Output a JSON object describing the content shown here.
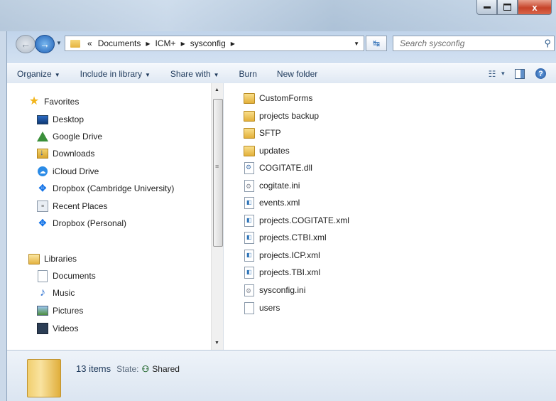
{
  "window": {
    "caption_buttons": [
      "minimize",
      "maximize",
      "close"
    ],
    "close_glyph": "x"
  },
  "address": {
    "overflow": "«",
    "crumbs": [
      "Documents",
      "ICM+",
      "sysconfig"
    ],
    "search_placeholder": "Search sysconfig"
  },
  "toolbar": {
    "organize": "Organize",
    "include": "Include in library",
    "share": "Share with",
    "burn": "Burn",
    "new_folder": "New folder"
  },
  "nav": {
    "favorites_label": "Favorites",
    "favorites": [
      "Desktop",
      "Google Drive",
      "Downloads",
      "iCloud Drive",
      "Dropbox (Cambridge University)",
      "Recent Places",
      "Dropbox (Personal)"
    ],
    "libraries_label": "Libraries",
    "libraries": [
      "Documents",
      "Music",
      "Pictures",
      "Videos"
    ]
  },
  "files": [
    {
      "name": "CustomForms",
      "type": "folder"
    },
    {
      "name": "projects backup",
      "type": "folder"
    },
    {
      "name": "SFTP",
      "type": "folder"
    },
    {
      "name": "updates",
      "type": "folder"
    },
    {
      "name": "COGITATE.dll",
      "type": "dll"
    },
    {
      "name": "cogitate.ini",
      "type": "ini"
    },
    {
      "name": "events.xml",
      "type": "xml"
    },
    {
      "name": "projects.COGITATE.xml",
      "type": "xml"
    },
    {
      "name": "projects.CTBI.xml",
      "type": "xml"
    },
    {
      "name": "projects.ICP.xml",
      "type": "xml"
    },
    {
      "name": "projects.TBI.xml",
      "type": "xml"
    },
    {
      "name": "sysconfig.ini",
      "type": "ini"
    },
    {
      "name": "users",
      "type": "file"
    }
  ],
  "details": {
    "count": "13 items",
    "state_label": "State:",
    "state_value": "Shared"
  }
}
